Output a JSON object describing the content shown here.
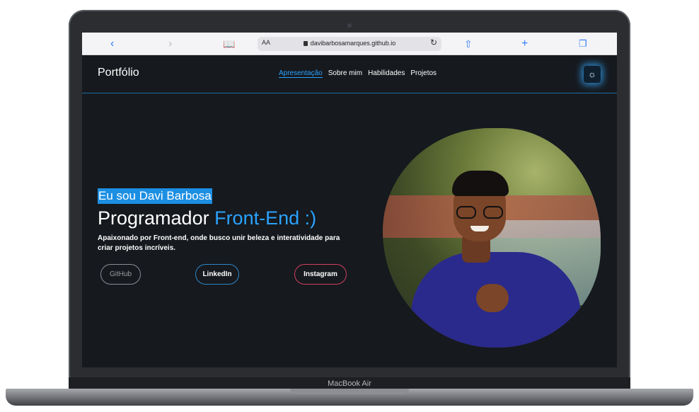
{
  "browser": {
    "aa_label": "AA",
    "url": "davibarbosamarques.github.io"
  },
  "device": {
    "model": "MacBook Air"
  },
  "site": {
    "brand": "Portfólio",
    "nav": [
      {
        "label": "Apresentação",
        "active": true
      },
      {
        "label": "Sobre mim",
        "active": false
      },
      {
        "label": "Habilidades",
        "active": false
      },
      {
        "label": "Projetos",
        "active": false
      }
    ],
    "theme_icon": "sun-icon"
  },
  "hero": {
    "intro": "Eu sou Davi Barbosa",
    "headline_main": "Programador ",
    "headline_accent": "Front-End :)",
    "description": "Apaixonado por Front-end, onde busco unir beleza e interatividade para criar projetos incríveis.",
    "social": {
      "github": "GitHub",
      "linkedin": "LinkedIn",
      "instagram": "Instagram"
    }
  },
  "colors": {
    "accent": "#2aa3ff",
    "background": "#16191e",
    "instagram_border": "#d0405f"
  }
}
